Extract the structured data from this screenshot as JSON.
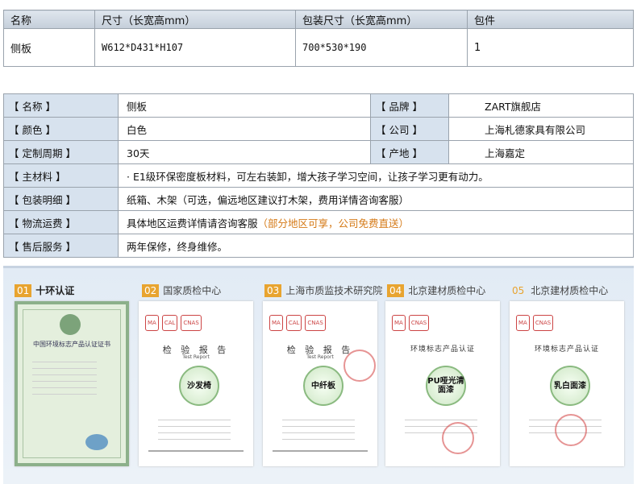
{
  "top_table": {
    "headers": [
      "名称",
      "尺寸（长宽高mm）",
      "包装尺寸（长宽高mm）",
      "包件"
    ],
    "row": [
      "侧板",
      "W612*D431*H107",
      "700*530*190",
      "1"
    ]
  },
  "specs": {
    "name_label": "【 名称 】",
    "name_value": "侧板",
    "brand_label": "【 品牌 】",
    "brand_value": "ZART旗舰店",
    "color_label": "【 颜色 】",
    "color_value": "白色",
    "company_label": "【 公司 】",
    "company_value": "上海札德家具有限公司",
    "cycle_label": "【 定制周期 】",
    "cycle_value": "30天",
    "origin_label": "【 产地 】",
    "origin_value": "上海嘉定",
    "material_label": "【 主材料 】",
    "material_value": "· E1级环保密度板材料，可左右装卸，增大孩子学习空间，让孩子学习更有动力。",
    "package_label": "【 包装明细 】",
    "package_value": "纸箱、木架（可选，偏远地区建议打木架，费用详情咨询客服）",
    "shipping_label": "【 物流运费 】",
    "shipping_value": "具体地区运费详情请咨询客服",
    "shipping_highlight": "（部分地区可享，公司免费直送）",
    "service_label": "【 售后服务 】",
    "service_value": "两年保修，终身维修。"
  },
  "certs": [
    {
      "num": "01",
      "title": "十环认证"
    },
    {
      "num": "02",
      "title": "国家质检中心"
    },
    {
      "num": "03",
      "title": "上海市质监技术研究院"
    },
    {
      "num": "04",
      "title": "北京建材质检中心"
    },
    {
      "num": "05",
      "title": "北京建材质检中心"
    }
  ],
  "card_texts": {
    "green_title": "中国环境标志产品认证证书",
    "report_title": "检 验 报 告",
    "report_sub": "Test Report",
    "env_title": "环境标志产品认证",
    "stamp1": "沙发椅",
    "stamp2": "中纤板",
    "stamp3": "PU哑光清面漆",
    "stamp4": "乳白面漆"
  },
  "colors": {
    "accent": "#e8a430",
    "label_bg": "#d7e2ee",
    "highlight": "#d57a17"
  }
}
